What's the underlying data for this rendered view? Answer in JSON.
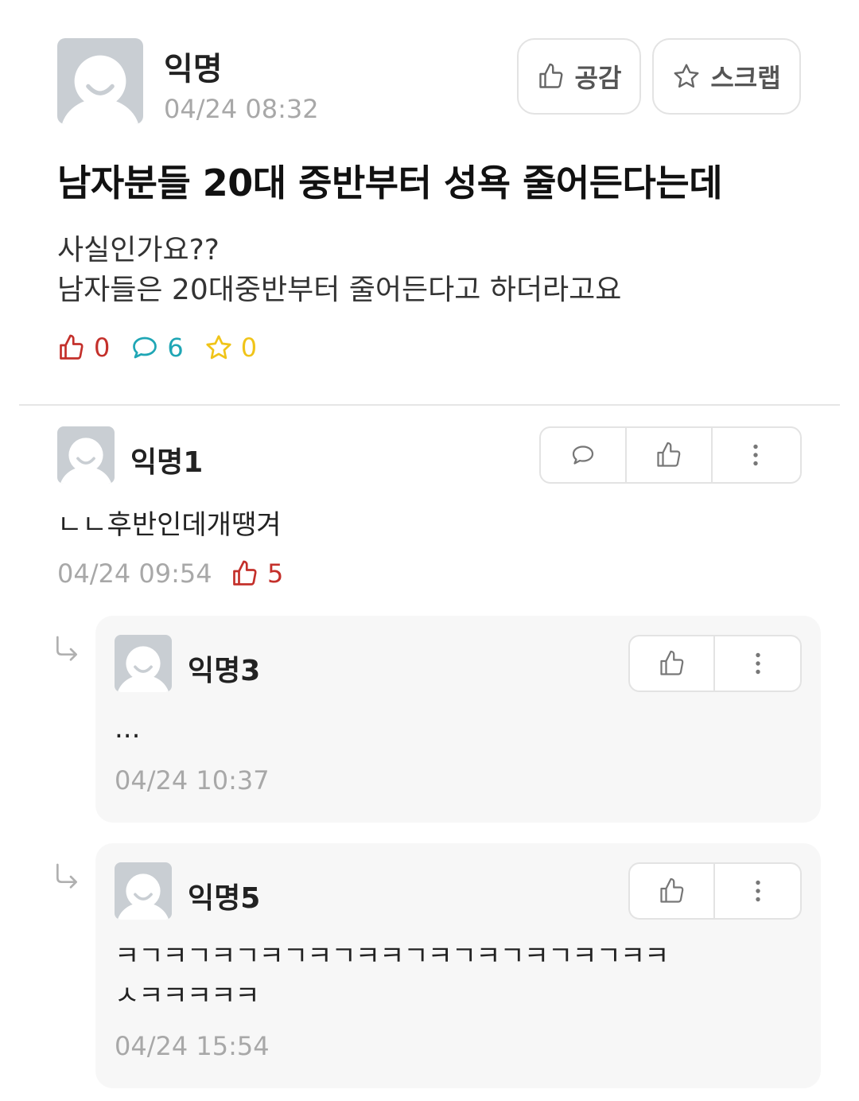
{
  "post": {
    "author": "익명",
    "time": "04/24 08:32",
    "title": "남자분들 20대 중반부터 성욕 줄어든다는데",
    "body_line1": "사실인가요??",
    "body_line2": "남자들은 20대중반부터 줄어든다고 하더라고요",
    "like_label": "공감",
    "scrap_label": "스크랩",
    "stats": {
      "likes": "0",
      "comments": "6",
      "scraps": "0"
    }
  },
  "comments": [
    {
      "author": "익명1",
      "text": "ㄴㄴ후반인데개땡겨",
      "time": "04/24 09:54",
      "likes": "5"
    }
  ],
  "replies": [
    {
      "author": "익명3",
      "text": "...",
      "time": "04/24 10:37"
    },
    {
      "author": "익명5",
      "text_line1": "ㅋㄱㅋㄱㅋㄱㅋㄱㅋㄱㅋㅋㄱㅋㄱㅋㄱㅋㄱㅋㄱㅋㅋ",
      "text_line2": "ㅅㅋㅋㅋㅋㅋ",
      "time": "04/24 15:54"
    }
  ],
  "colors": {
    "like_red": "#c4302b",
    "comment_teal": "#1fa6b5",
    "scrap_yellow": "#f0c419",
    "meta_gray": "#a8a8a8"
  },
  "icons": [
    "thumbs-up-icon",
    "star-icon",
    "speech-bubble-icon",
    "more-vertical-icon",
    "reply-arrow-icon",
    "avatar-icon"
  ]
}
